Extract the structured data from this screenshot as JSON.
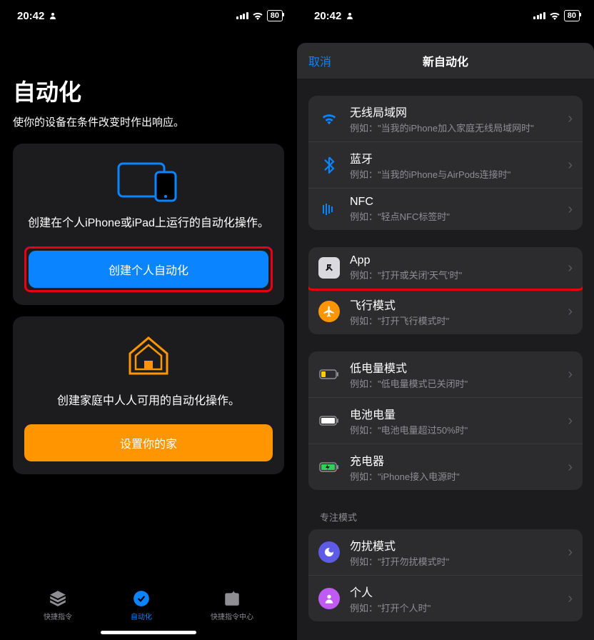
{
  "status": {
    "time": "20:42",
    "battery": "80"
  },
  "left": {
    "title": "自动化",
    "subtitle": "使你的设备在条件改变时作出响应。",
    "card1_text": "创建在个人iPhone或iPad上运行的自动化操作。",
    "btn_create": "创建个人自动化",
    "card2_text": "创建家庭中人人可用的自动化操作。",
    "btn_home": "设置你的家",
    "tabs": {
      "shortcuts": "快捷指令",
      "automation": "自动化",
      "gallery": "快捷指令中心"
    }
  },
  "right": {
    "cancel": "取消",
    "modal_title": "新自动化",
    "group1": [
      {
        "icon": "wifi",
        "title": "无线局域网",
        "sub": "例如：\"当我的iPhone加入家庭无线局域网时\""
      },
      {
        "icon": "bluetooth",
        "title": "蓝牙",
        "sub": "例如：\"当我的iPhone与AirPods连接时\""
      },
      {
        "icon": "nfc",
        "title": "NFC",
        "sub": "例如：\"轻点NFC标签时\""
      }
    ],
    "group2": [
      {
        "icon": "app",
        "title": "App",
        "sub": "例如：\"打开或关闭'天气'时\""
      },
      {
        "icon": "airplane",
        "title": "飞行模式",
        "sub": "例如：\"打开飞行模式时\""
      }
    ],
    "group3": [
      {
        "icon": "lowpower",
        "title": "低电量模式",
        "sub": "例如：\"低电量模式已关闭时\""
      },
      {
        "icon": "battery",
        "title": "电池电量",
        "sub": "例如：\"电池电量超过50%时\""
      },
      {
        "icon": "charger",
        "title": "充电器",
        "sub": "例如：\"iPhone接入电源时\""
      }
    ],
    "focus_header": "专注模式",
    "group4": [
      {
        "icon": "dnd",
        "title": "勿扰模式",
        "sub": "例如：\"打开勿扰模式时\""
      },
      {
        "icon": "personal",
        "title": "个人",
        "sub": "例如：\"打开个人时\""
      }
    ]
  }
}
